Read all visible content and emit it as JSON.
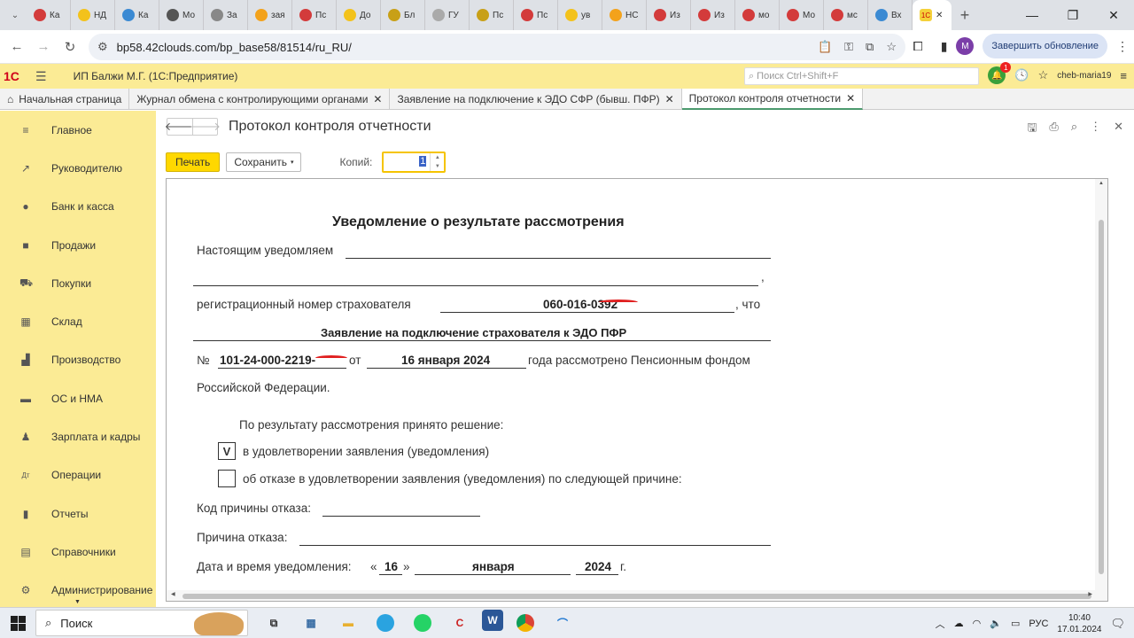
{
  "browser": {
    "tabs": [
      {
        "label": "Ка",
        "color": "#d33b3b"
      },
      {
        "label": "НД",
        "color": "#f3c21b"
      },
      {
        "label": "Ка",
        "color": "#3b8ad3"
      },
      {
        "label": "Мо",
        "color": "#555555"
      },
      {
        "label": "За",
        "color": "#888888"
      },
      {
        "label": "зая",
        "color": "#f3a21b"
      },
      {
        "label": "Пс",
        "color": "#d33b3b"
      },
      {
        "label": "До",
        "color": "#f3c21b"
      },
      {
        "label": "Бл",
        "color": "#c8a017"
      },
      {
        "label": "ГУ",
        "color": "#aaaaaa"
      },
      {
        "label": "Пс",
        "color": "#c8a017"
      },
      {
        "label": "Пс",
        "color": "#d33b3b"
      },
      {
        "label": "ув",
        "color": "#f3c21b"
      },
      {
        "label": "НС",
        "color": "#f3a21b"
      },
      {
        "label": "Из",
        "color": "#d33b3b"
      },
      {
        "label": "Из",
        "color": "#d33b3b"
      },
      {
        "label": "мо",
        "color": "#d33b3b"
      },
      {
        "label": "Мо",
        "color": "#d33b3b"
      },
      {
        "label": "мс",
        "color": "#d33b3b"
      },
      {
        "label": "Вх",
        "color": "#3b8ad3"
      }
    ],
    "active_tab_icon": "1С",
    "url": "bp58.42clouds.com/bp_base58/81514/ru_RU/",
    "update_button": "Завершить обновление",
    "avatar_letter": "M"
  },
  "app": {
    "logo": "1С",
    "title": "ИП Балжи М.Г.  (1С:Предприятие)",
    "search_placeholder": "Поиск Ctrl+Shift+F",
    "notification_count": "1",
    "user": "cheb-maria19"
  },
  "open_tabs": [
    {
      "label": "Начальная страница",
      "closable": false
    },
    {
      "label": "Журнал обмена с контролирующими органами",
      "closable": true
    },
    {
      "label": "Заявление на подключение к ЭДО СФР (бывш. ПФР)",
      "closable": true
    },
    {
      "label": "Протокол контроля отчетности",
      "closable": true,
      "active": true
    }
  ],
  "sidebar": {
    "items": [
      {
        "label": "Главное",
        "icon": "menu-icon"
      },
      {
        "label": "Руководителю",
        "icon": "chart-icon"
      },
      {
        "label": "Банк и касса",
        "icon": "coin-icon"
      },
      {
        "label": "Продажи",
        "icon": "bag-icon"
      },
      {
        "label": "Покупки",
        "icon": "cart-icon"
      },
      {
        "label": "Склад",
        "icon": "warehouse-icon"
      },
      {
        "label": "Производство",
        "icon": "factory-icon"
      },
      {
        "label": "ОС и НМА",
        "icon": "truck-icon"
      },
      {
        "label": "Зарплата и кадры",
        "icon": "person-icon"
      },
      {
        "label": "Операции",
        "icon": "operations-icon"
      },
      {
        "label": "Отчеты",
        "icon": "report-icon"
      },
      {
        "label": "Справочники",
        "icon": "book-icon"
      },
      {
        "label": "Администрирование",
        "icon": "gear-icon"
      }
    ]
  },
  "form": {
    "title": "Протокол контроля отчетности",
    "print_button": "Печать",
    "save_button": "Сохранить",
    "copies_label": "Копий:",
    "copies_value": "1"
  },
  "document": {
    "heading": "Уведомление о результате рассмотрения",
    "notify_label": "Настоящим уведомляем",
    "comma": ",",
    "reg_label": "регистрационный номер страхователя",
    "reg_number": "060-016-0392",
    "reg_suffix": ", что",
    "statement": "Заявление на подключение страхователя к ЭДО ПФР",
    "no_label": "№",
    "doc_number": "101-24-000-2219-",
    "from_label": "от",
    "date_text": "16 января 2024",
    "considered_text": "года рассмотрено Пенсионным фондом",
    "federation": "Российской Федерации.",
    "decision_label": "По результату рассмотрения принято решение:",
    "approve_mark": "V",
    "approve_text": "в удовлетворении заявления (уведомления)",
    "reject_text": "об отказе в удовлетворении заявления (уведомления) по следующей причине:",
    "reject_code_label": "Код причины отказа:",
    "reject_reason_label": "Причина отказа:",
    "datetime_label": "Дата и время уведомления:",
    "quote_open": "«",
    "day": "16",
    "quote_close": "»",
    "month": "января",
    "year": "2024",
    "year_suffix": "г."
  },
  "taskbar": {
    "search": "Поиск",
    "lang": "РУС",
    "time": "10:40",
    "date": "17.01.2024",
    "notif_count": "1"
  }
}
